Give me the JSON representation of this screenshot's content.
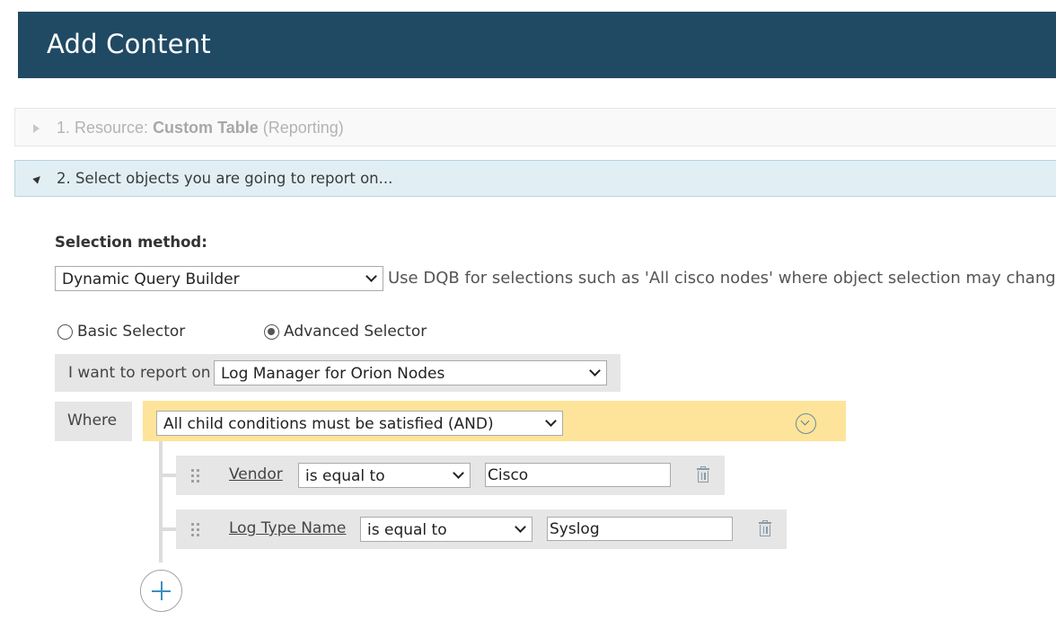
{
  "header": {
    "title": "Add Content"
  },
  "steps": {
    "step1": {
      "prefix": "1. Resource: ",
      "resource": "Custom Table",
      "suffix": "(Reporting)"
    },
    "step2": {
      "label": "2. Select objects you are going to report on..."
    }
  },
  "selection": {
    "method_label": "Selection method:",
    "method_value": "Dynamic Query Builder",
    "method_hint": "Use DQB for selections such as 'All cisco nodes' where object selection may change"
  },
  "selector_mode": {
    "basic_label": "Basic Selector",
    "advanced_label": "Advanced Selector",
    "selected": "Advanced Selector"
  },
  "report_on": {
    "label": "I want to report on",
    "value": "Log Manager for Orion Nodes"
  },
  "where": {
    "label": "Where",
    "condition": "All child conditions must be satisfied (AND)"
  },
  "rules": [
    {
      "field": "Vendor",
      "operator": "is equal to",
      "value": "Cisco"
    },
    {
      "field": "Log Type Name",
      "operator": "is equal to",
      "value": "Syslog"
    }
  ]
}
